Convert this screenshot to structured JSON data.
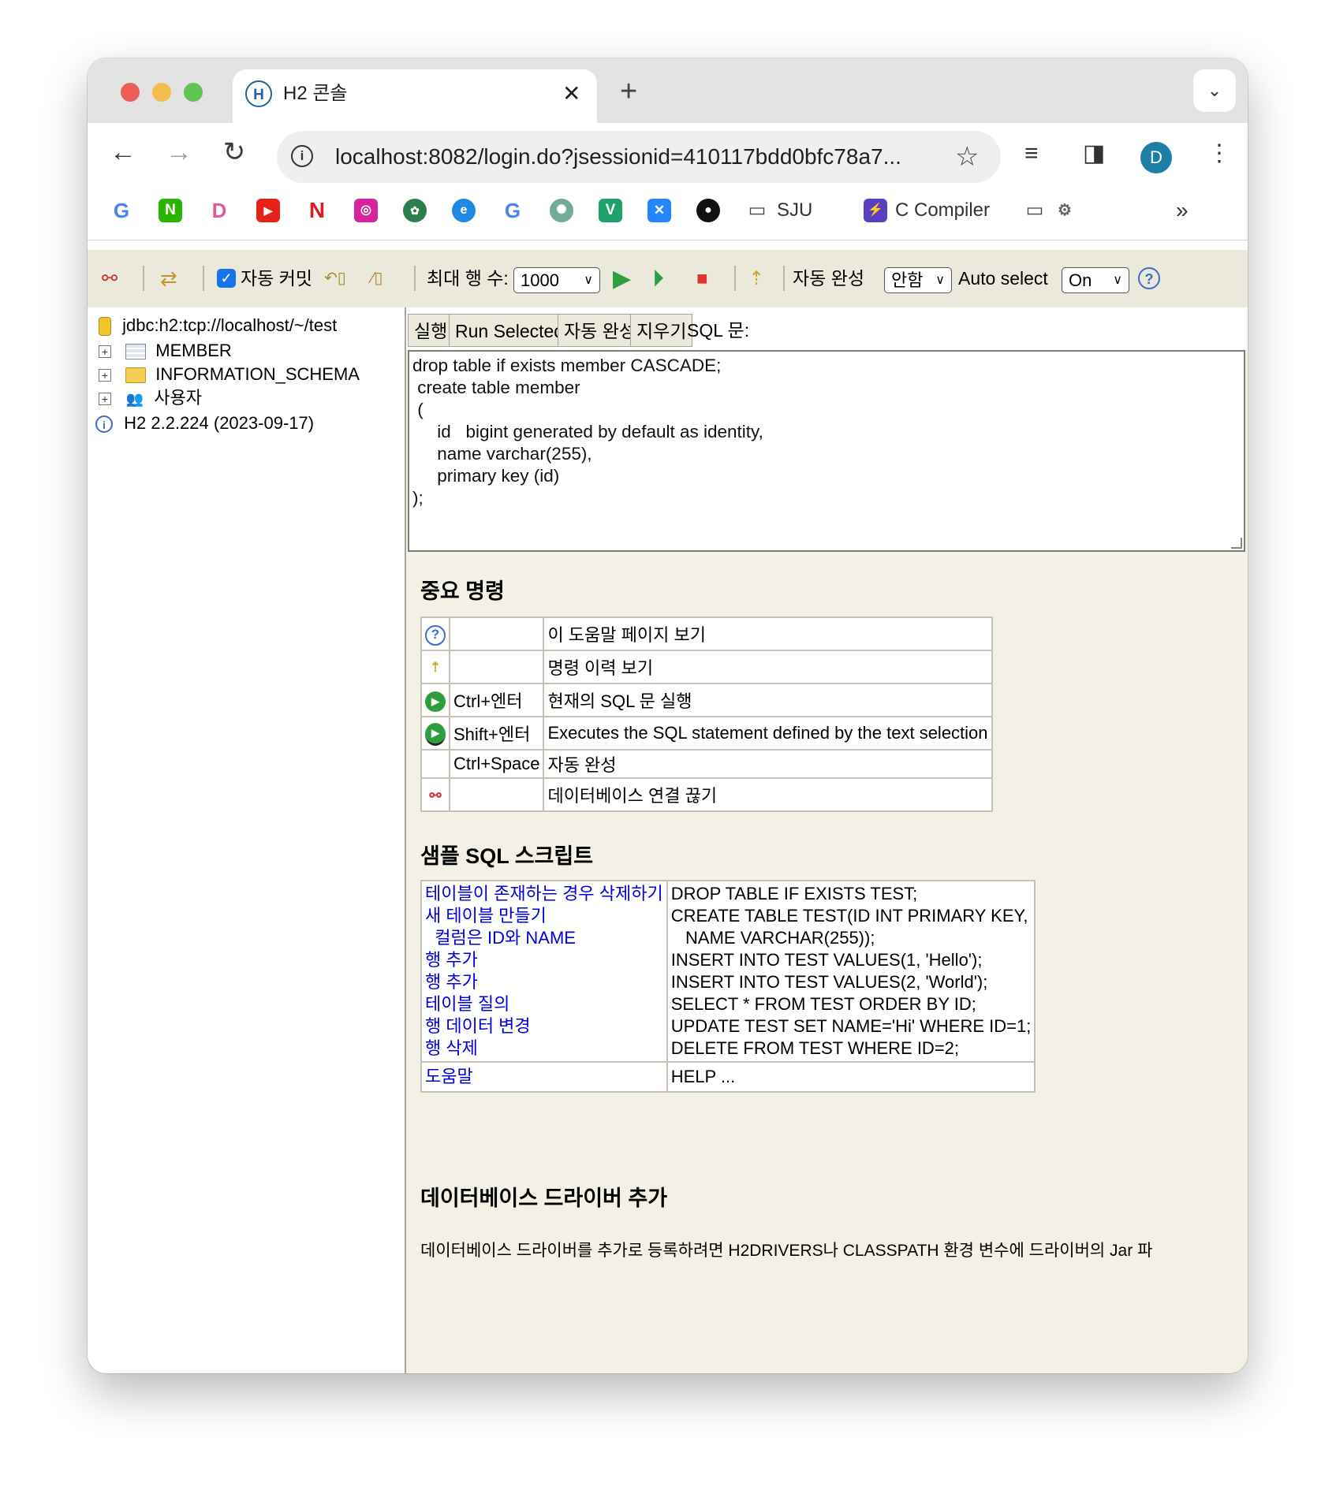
{
  "browser": {
    "tab_title": "H2 콘솔",
    "url": "localhost:8082/login.do?jsessionid=410117bdd0bfc78a7...",
    "avatar_letter": "D",
    "bookmarks": [
      "SJU",
      "C Compiler"
    ]
  },
  "h2_toolbar": {
    "auto_commit_label": "자동 커밋",
    "max_rows_label": "최대 행 수:",
    "max_rows_value": "1000",
    "autocomplete_label": "자동 완성",
    "autocomplete_value": "안함",
    "auto_select_label": "Auto select",
    "auto_select_value": "On"
  },
  "tree": {
    "connection": "jdbc:h2:tcp://localhost/~/test",
    "items": [
      "MEMBER",
      "INFORMATION_SCHEMA",
      "사용자"
    ],
    "version": "H2 2.2.224 (2023-09-17)"
  },
  "editor": {
    "buttons": [
      "실행",
      "Run Selected",
      "자동 완성",
      "지우기"
    ],
    "sql_label": "SQL 문:",
    "lines": [
      "drop table if exists member CASCADE;",
      " create table member",
      " (",
      "     id   bigint generated by default as identity,",
      "     name varchar(255),",
      "     primary key (id)",
      ");"
    ]
  },
  "help": {
    "important_title": "중요 명령",
    "commands": [
      {
        "icon": "help-icon",
        "key": "",
        "desc": "이 도움말 페이지 보기"
      },
      {
        "icon": "history-icon",
        "key": "",
        "desc": "명령 이력 보기"
      },
      {
        "icon": "run-icon",
        "key": "Ctrl+엔터",
        "desc": "현재의 SQL 문 실행"
      },
      {
        "icon": "run-selected-icon",
        "key": "Shift+엔터",
        "desc": "Executes the SQL statement defined by the text selection"
      },
      {
        "icon": "",
        "key": "Ctrl+Space",
        "desc": "자동 완성"
      },
      {
        "icon": "disconnect-icon",
        "key": "",
        "desc": "데이터베이스 연결 끊기"
      }
    ],
    "sample_title": "샘플 SQL 스크립트",
    "sample_links": [
      "테이블이 존재하는 경우 삭제하기",
      "새 테이블 만들기",
      "  컬럼은 ID와 NAME",
      "행 추가",
      "행 추가",
      "테이블 질의",
      "행 데이터 변경",
      "행 삭제"
    ],
    "sample_sql": [
      "DROP TABLE IF EXISTS TEST;",
      "CREATE TABLE TEST(ID INT PRIMARY KEY,",
      "   NAME VARCHAR(255));",
      "INSERT INTO TEST VALUES(1, 'Hello');",
      "INSERT INTO TEST VALUES(2, 'World');",
      "SELECT * FROM TEST ORDER BY ID;",
      "UPDATE TEST SET NAME='Hi' WHERE ID=1;",
      "DELETE FROM TEST WHERE ID=2;"
    ],
    "help_link": "도움말",
    "help_sql": "HELP ...",
    "driver_title": "데이터베이스 드라이버 추가",
    "driver_text": "데이터베이스 드라이버를 추가로 등록하려면 H2DRIVERS나 CLASSPATH 환경 변수에 드라이버의 Jar 파"
  }
}
